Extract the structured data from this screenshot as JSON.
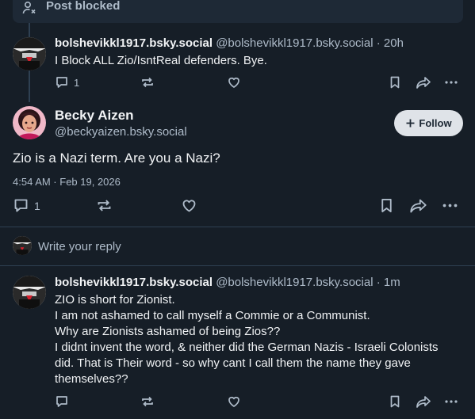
{
  "blocked": {
    "label": "Post blocked",
    "icon": "person-x-icon"
  },
  "post1": {
    "name": "bolshevikkl1917.bsky.social",
    "meta": "@bolshevikkl1917.bsky.social · 20h",
    "text": "I Block ALL Zio/IsntReal defenders. Bye.",
    "reply_count": "1"
  },
  "main_post": {
    "name": "Becky Aizen",
    "handle": "@beckyaizen.bsky.social",
    "follow_label": "Follow",
    "text": "Zio is a Nazi term. Are you a Nazi?",
    "timestamp": "4:54 AM · Feb 19, 2026",
    "reply_count": "1"
  },
  "reply_bar": {
    "placeholder": "Write your reply"
  },
  "post2": {
    "name": "bolshevikkl1917.bsky.social",
    "meta": "@bolshevikkl1917.bsky.social · 1m",
    "lines": [
      "ZIO is short for Zionist.",
      "I am not ashamed to call myself a Commie or a Communist.",
      "Why are Zionists ashamed of being Zios??",
      "I didnt invent the word, & neither did the German Nazis - Israeli Colonists",
      "did. That is Their word - so why cant I call them the name they gave",
      "themselves??"
    ]
  },
  "colors": {
    "background": "#161e27",
    "text": "#f1f3f5",
    "muted": "#aebbc9",
    "divider": "#2e4052",
    "follow_bg": "#dfe3e8"
  }
}
